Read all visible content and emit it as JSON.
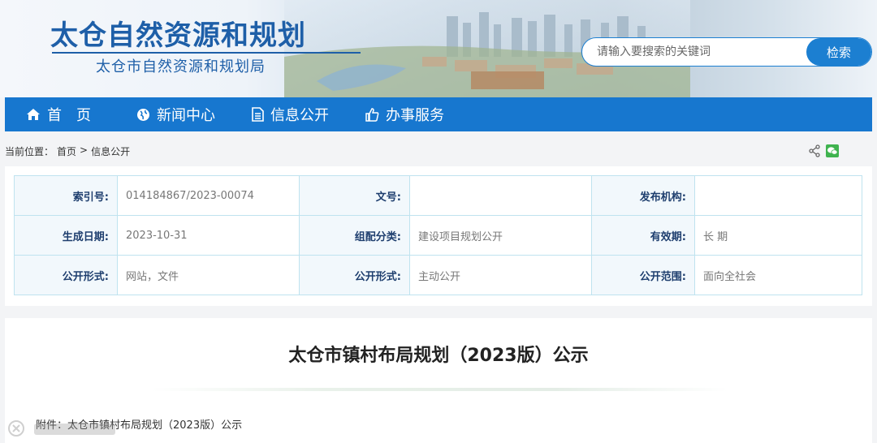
{
  "header": {
    "site_title": "太仓自然资源和规划",
    "site_subtitle": "太仓市自然资源和规划局",
    "search_placeholder": "请输入要搜索的关键词",
    "search_button": "检索"
  },
  "nav": {
    "items": [
      {
        "label": "首　页",
        "icon": "home-icon"
      },
      {
        "label": "新闻中心",
        "icon": "globe-icon"
      },
      {
        "label": "信息公开",
        "icon": "document-icon"
      },
      {
        "label": "办事服务",
        "icon": "thumbs-up-icon"
      }
    ]
  },
  "breadcrumb": {
    "prefix": "当前位置：",
    "home": "首页",
    "separator": ">",
    "current": "信息公开"
  },
  "info": {
    "rows": [
      [
        {
          "label": "索引号:",
          "value": "014184867/2023-00074"
        },
        {
          "label": "文号:",
          "value": ""
        },
        {
          "label": "发布机构:",
          "value": ""
        }
      ],
      [
        {
          "label": "生成日期:",
          "value": "2023-10-31"
        },
        {
          "label": "组配分类:",
          "value": "建设项目规划公开"
        },
        {
          "label": "有效期:",
          "value": "长 期"
        }
      ],
      [
        {
          "label": "公开形式:",
          "value": "网站，文件"
        },
        {
          "label": "公开形式:",
          "value": "主动公开"
        },
        {
          "label": "公开范围:",
          "value": "面向全社会"
        }
      ]
    ]
  },
  "article": {
    "title": "太仓市镇村布局规划（2023版）公示",
    "attachment": "附件：太仓市镇村布局规划（2023版）公示"
  },
  "colors": {
    "brand_blue": "#1777cf",
    "title_blue": "#1e5fa8",
    "table_border": "#bfe3ef"
  }
}
